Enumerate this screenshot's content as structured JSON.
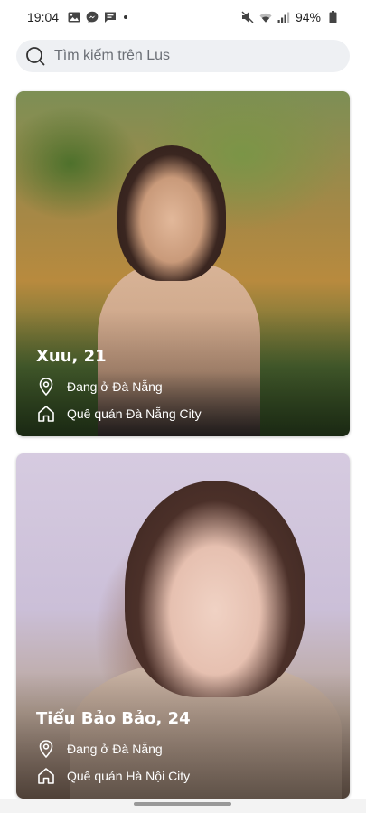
{
  "status_bar": {
    "time": "19:04",
    "battery": "94%",
    "icons": [
      "gallery-icon",
      "messenger-icon",
      "message-icon",
      "mute-icon",
      "wifi-icon",
      "signal-icon",
      "battery-icon"
    ]
  },
  "search": {
    "placeholder": "Tìm kiếm trên Lus"
  },
  "profiles": [
    {
      "name": "Xuu, 21",
      "location": "Đang ở Đà Nẵng",
      "hometown": "Quê quán Đà Nẵng City"
    },
    {
      "name": "Tiểu Bảo Bảo, 24",
      "location": "Đang ở Đà Nẵng",
      "hometown": "Quê quán Hà Nội City"
    }
  ],
  "colors": {
    "search_bg": "#eef0f3",
    "text_light": "#ffffff"
  }
}
